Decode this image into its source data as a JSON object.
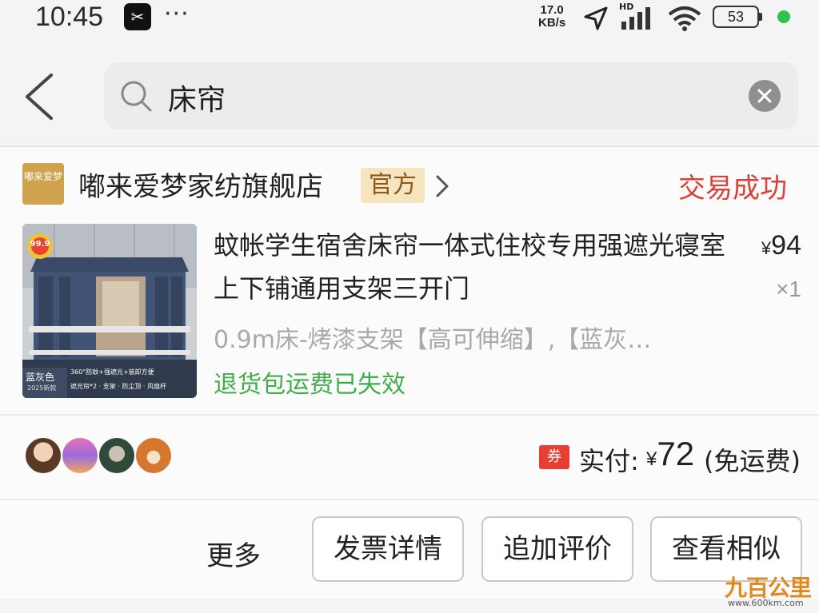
{
  "status_bar": {
    "time": "10:45",
    "app_icon": "capcut-icon",
    "dots": "···",
    "net_speed_value": "17.0",
    "net_speed_unit": "KB/s",
    "hd_label": "HD",
    "battery": "53",
    "accent_green": "#2ec24f"
  },
  "search": {
    "query": "床帘"
  },
  "order": {
    "shop_logo_text": "嘟来爱梦",
    "shop_name": "嘟来爱梦家纺旗舰店",
    "official_badge": "官方",
    "status": "交易成功",
    "status_color": "#d9423a",
    "product": {
      "title": "蚊帐学生宿舍床帘一体式住校专用强遮光寝室上下铺通用支架三开门",
      "price_symbol": "¥",
      "price": "94",
      "quantity": "×1",
      "spec": "0.9m床-烤漆支架【高可伸缩】,【蓝灰…",
      "return_note": "退货包运费已失效",
      "thumb_badge": "99.9",
      "thumb_color_label": "蓝灰色",
      "thumb_year": "2025新款",
      "thumb_feature_line1": "360°防蚊+强遮光+装卸方便",
      "thumb_feature_line2": "遮光帘*2 · 支架 · 防尘顶 · 风扇杆"
    },
    "coupon_icon": "券",
    "paid_label": "实付:",
    "paid_symbol": "¥",
    "paid_amount": "72",
    "shipping_note": "(免运费)",
    "actions": {
      "more": "更多",
      "invoice": "发票详情",
      "append_review": "追加评价",
      "similar": "查看相似"
    }
  },
  "watermark": {
    "text": "九百公里",
    "url": "www.600km.com"
  }
}
